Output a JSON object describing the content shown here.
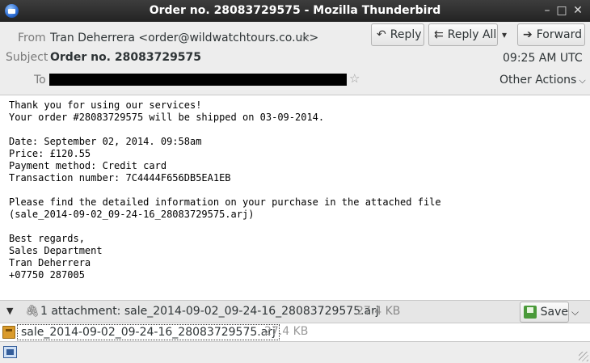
{
  "window": {
    "title": "Order no. 28083729575 - Mozilla Thunderbird",
    "controls": [
      "–",
      "□",
      "✕"
    ]
  },
  "header": {
    "from_label": "From",
    "from_value": "Tran Deherrera <order@wildwatchtours.co.uk>",
    "subject_label": "Subject",
    "subject_value": "Order no. 28083729575",
    "to_label": "To",
    "time": "09:25 AM UTC",
    "reply_label": "Reply",
    "reply_all_label": "Reply All",
    "forward_label": "Forward",
    "other_actions_label": "Other Actions"
  },
  "body": {
    "lines": [
      "Thank you for using our services!",
      "Your order #28083729575 will be shipped on 03-09-2014.",
      "",
      "Date: September 02, 2014. 09:58am",
      "Price: £120.55",
      "Payment method: Credit card",
      "Transaction number: 7C4444F656DB5EA1EB",
      "",
      "Please find the detailed information on your purchase in the attached file",
      "(sale_2014-09-02_09-24-16_28083729575.arj)",
      "",
      "Best regards,",
      "Sales Department",
      "Tran Deherrera",
      "+07750 287005"
    ]
  },
  "attachments": {
    "summary": "1 attachment: sale_2014-09-02_09-24-16_28083729575.arj",
    "summary_size": "27.4 KB",
    "save_label": "Save",
    "items": [
      {
        "name": "sale_2014-09-02_09-24-16_28083729575.arj",
        "size": "27.4 KB"
      }
    ]
  },
  "icons": {
    "app": "thunderbird-icon",
    "star": "star-icon",
    "reply": "reply-arrow-icon",
    "reply_all": "reply-all-arrow-icon",
    "forward": "forward-arrow-icon",
    "paperclip": "paperclip-icon",
    "save": "save-icon",
    "file": "archive-file-icon",
    "status": "online-status-icon"
  }
}
